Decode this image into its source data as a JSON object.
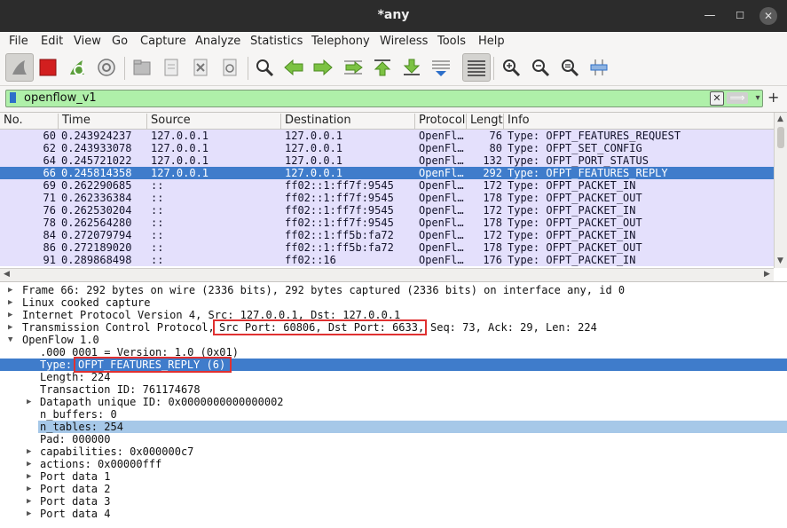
{
  "window": {
    "title": "*any",
    "min": "—",
    "max": "☐",
    "close": "✕"
  },
  "menu": [
    "File",
    "Edit",
    "View",
    "Go",
    "Capture",
    "Analyze",
    "Statistics",
    "Telephony",
    "Wireless",
    "Tools",
    "Help"
  ],
  "filter": {
    "value": "openflow_v1",
    "clear": "✕",
    "apply": "⟹",
    "dropdown": "▾",
    "add": "+"
  },
  "columns": [
    "No.",
    "Time",
    "Source",
    "Destination",
    "Protocol",
    "Length",
    "Info"
  ],
  "packets": [
    {
      "no": "60",
      "time": "0.243924237",
      "src": "127.0.0.1",
      "dst": "127.0.0.1",
      "proto": "OpenFl…",
      "len": "76",
      "info": "Type: OFPT_FEATURES_REQUEST"
    },
    {
      "no": "62",
      "time": "0.243933078",
      "src": "127.0.0.1",
      "dst": "127.0.0.1",
      "proto": "OpenFl…",
      "len": "80",
      "info": "Type: OFPT_SET_CONFIG"
    },
    {
      "no": "64",
      "time": "0.245721022",
      "src": "127.0.0.1",
      "dst": "127.0.0.1",
      "proto": "OpenFl…",
      "len": "132",
      "info": "Type: OFPT_PORT_STATUS"
    },
    {
      "no": "66",
      "time": "0.245814358",
      "src": "127.0.0.1",
      "dst": "127.0.0.1",
      "proto": "OpenFl…",
      "len": "292",
      "info": "Type: OFPT_FEATURES_REPLY"
    },
    {
      "no": "69",
      "time": "0.262290685",
      "src": "::",
      "dst": "ff02::1:ff7f:9545",
      "proto": "OpenFl…",
      "len": "172",
      "info": "Type: OFPT_PACKET_IN"
    },
    {
      "no": "71",
      "time": "0.262336384",
      "src": "::",
      "dst": "ff02::1:ff7f:9545",
      "proto": "OpenFl…",
      "len": "178",
      "info": "Type: OFPT_PACKET_OUT"
    },
    {
      "no": "76",
      "time": "0.262530204",
      "src": "::",
      "dst": "ff02::1:ff7f:9545",
      "proto": "OpenFl…",
      "len": "172",
      "info": "Type: OFPT_PACKET_IN"
    },
    {
      "no": "78",
      "time": "0.262564280",
      "src": "::",
      "dst": "ff02::1:ff7f:9545",
      "proto": "OpenFl…",
      "len": "178",
      "info": "Type: OFPT_PACKET_OUT"
    },
    {
      "no": "84",
      "time": "0.272079794",
      "src": "::",
      "dst": "ff02::1:ff5b:fa72",
      "proto": "OpenFl…",
      "len": "172",
      "info": "Type: OFPT_PACKET_IN"
    },
    {
      "no": "86",
      "time": "0.272189020",
      "src": "::",
      "dst": "ff02::1:ff5b:fa72",
      "proto": "OpenFl…",
      "len": "178",
      "info": "Type: OFPT_PACKET_OUT"
    },
    {
      "no": "91",
      "time": "0.289868498",
      "src": "::",
      "dst": "ff02::16",
      "proto": "OpenFl…",
      "len": "176",
      "info": "Type: OFPT_PACKET_IN"
    }
  ],
  "details": {
    "frame": "Frame 66: 292 bytes on wire (2336 bits), 292 bytes captured (2336 bits) on interface any, id 0",
    "linux": "Linux cooked capture",
    "ip": "Internet Protocol Version 4, Src: 127.0.0.1, Dst: 127.0.0.1",
    "tcp_a": "Transmission Control Protocol,",
    "tcp_b": "Src Port: 60806, Dst Port: 6633,",
    "tcp_c": "Seq: 73, Ack: 29, Len: 224",
    "openflow": "OpenFlow 1.0",
    "version": ".000 0001 = Version: 1.0 (0x01)",
    "type_label": "Type:",
    "type_value": "OFPT_FEATURES_REPLY (6)",
    "length": "Length: 224",
    "xid": "Transaction ID: 761174678",
    "dpid": "Datapath unique ID: 0x0000000000000002",
    "nbuffers": "n_buffers: 0",
    "ntables": "n_tables: 254",
    "pad": "Pad: 000000",
    "capabilities": "capabilities: 0x000000c7",
    "actions": "actions: 0x00000fff",
    "port1": "Port data 1",
    "port2": "Port data 2",
    "port3": "Port data 3",
    "port4": "Port data 4"
  },
  "colors": {
    "row_bg": "#e4e0fc",
    "selected": "#3f7ccb",
    "filter_ok": "#aff0a9",
    "annotation": "#e03131"
  }
}
